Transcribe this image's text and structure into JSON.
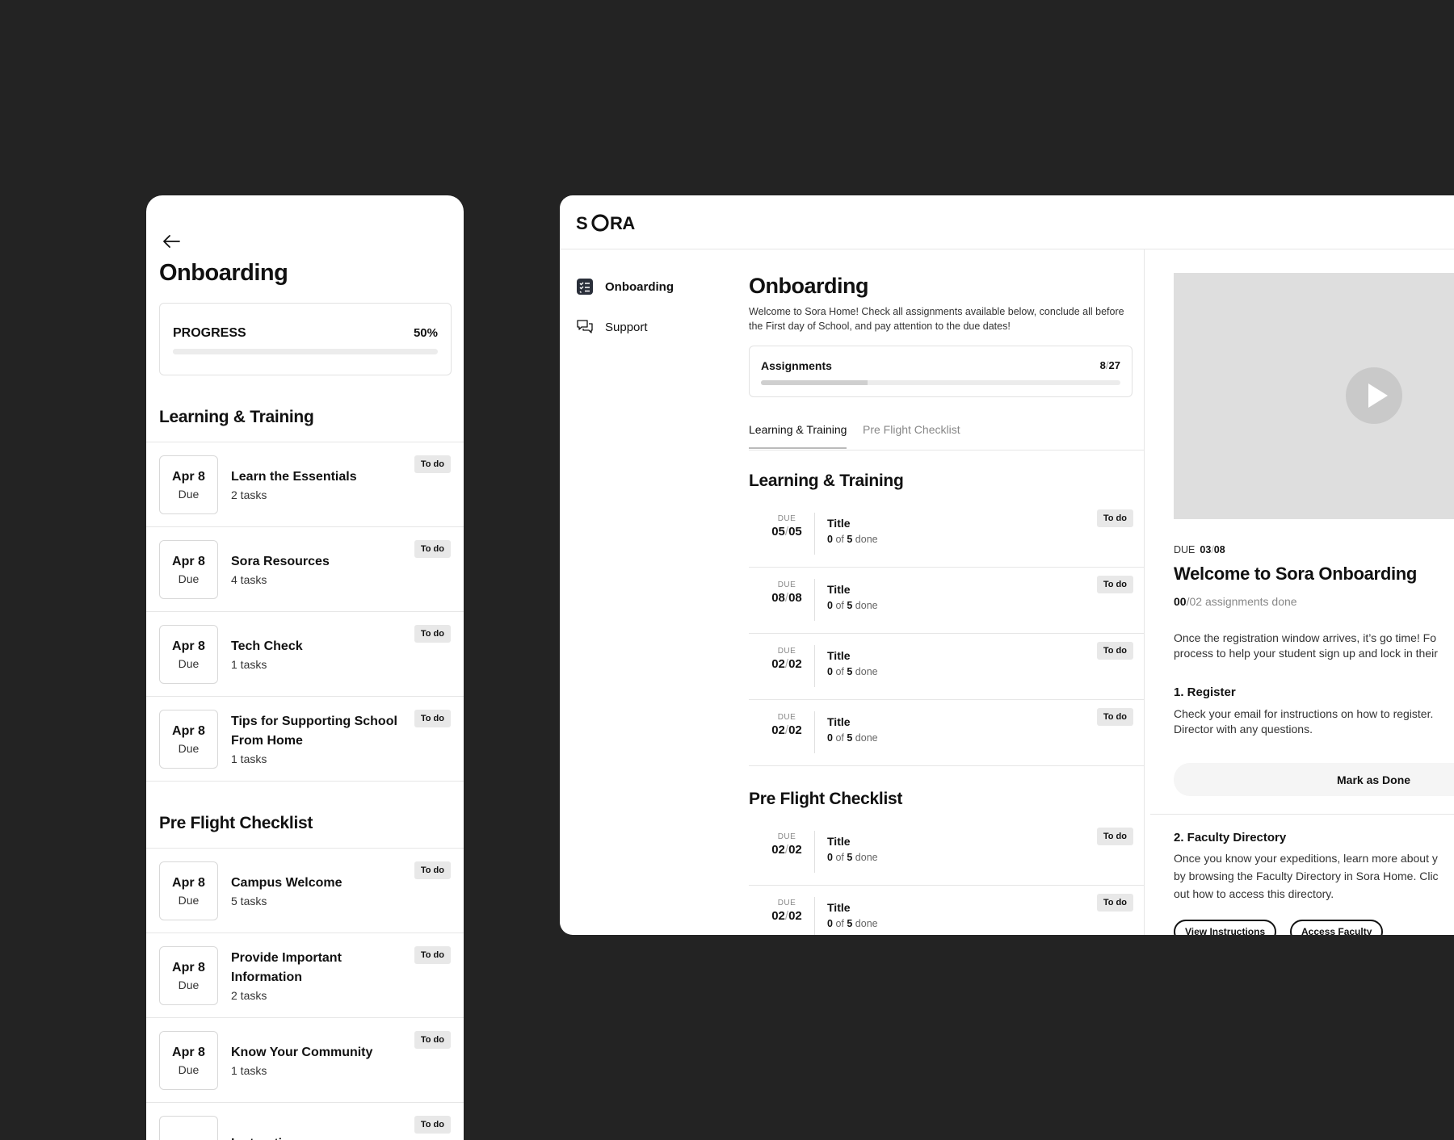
{
  "mobile": {
    "title": "Onboarding",
    "progress": {
      "label": "PROGRESS",
      "percent_text": "50%",
      "value": 0.5
    },
    "learning_title": "Learning & Training",
    "learning_items": [
      {
        "date": "Apr 8",
        "due": "Due",
        "title": "Learn the Essentials",
        "tasks": "2 tasks",
        "status": "To do"
      },
      {
        "date": "Apr 8",
        "due": "Due",
        "title": "Sora Resources",
        "tasks": "4 tasks",
        "status": "To do"
      },
      {
        "date": "Apr 8",
        "due": "Due",
        "title": "Tech Check",
        "tasks": "1 tasks",
        "status": "To do"
      },
      {
        "date": "Apr 8",
        "due": "Due",
        "title": "Tips for Supporting School From Home",
        "tasks": "1 tasks",
        "status": "To do"
      }
    ],
    "preflight_title": "Pre Flight Checklist",
    "preflight_items": [
      {
        "date": "Apr 8",
        "due": "Due",
        "title": "Campus Welcome",
        "tasks": "5 tasks",
        "status": "To do"
      },
      {
        "date": "Apr 8",
        "due": "Due",
        "title": "Provide Important Information",
        "tasks": "2 tasks",
        "status": "To do"
      },
      {
        "date": "Apr 8",
        "due": "Due",
        "title": "Know Your Community",
        "tasks": "1 tasks",
        "status": "To do"
      },
      {
        "date": "",
        "due": "",
        "title": "Instructions on",
        "tasks": "",
        "status": "To do"
      }
    ]
  },
  "desktop": {
    "logo_text": "SORA",
    "nav": [
      {
        "label": "Onboarding",
        "icon": "checklist-icon",
        "active": true
      },
      {
        "label": "Support",
        "icon": "chat-bubbles-icon",
        "active": false
      }
    ],
    "title": "Onboarding",
    "description": "Welcome to Sora Home! Check all assignments available below, conclude all before the First day of School, and pay attention to the due dates!",
    "assignments": {
      "label": "Assignments",
      "done": "8",
      "slash": "/",
      "total": "27",
      "value_done": 8,
      "value_total": 27
    },
    "tabs": [
      {
        "label": "Learning & Training",
        "active": true
      },
      {
        "label": "Pre Flight Checklist",
        "active": false
      }
    ],
    "learning_title": "Learning & Training",
    "learning_items": [
      {
        "due_label": "DUE",
        "month": "05",
        "day": "05",
        "title": "Title",
        "done": "0",
        "total": "5",
        "of": "of",
        "done_word": "done",
        "status": "To do"
      },
      {
        "due_label": "DUE",
        "month": "08",
        "day": "08",
        "title": "Title",
        "done": "0",
        "total": "5",
        "of": "of",
        "done_word": "done",
        "status": "To do"
      },
      {
        "due_label": "DUE",
        "month": "02",
        "day": "02",
        "title": "Title",
        "done": "0",
        "total": "5",
        "of": "of",
        "done_word": "done",
        "status": "To do"
      },
      {
        "due_label": "DUE",
        "month": "02",
        "day": "02",
        "title": "Title",
        "done": "0",
        "total": "5",
        "of": "of",
        "done_word": "done",
        "status": "To do"
      }
    ],
    "preflight_title": "Pre Flight Checklist",
    "preflight_items": [
      {
        "due_label": "DUE",
        "month": "02",
        "day": "02",
        "title": "Title",
        "done": "0",
        "total": "5",
        "of": "of",
        "done_word": "done",
        "status": "To do"
      },
      {
        "due_label": "DUE",
        "month": "02",
        "day": "02",
        "title": "Title",
        "done": "0",
        "total": "5",
        "of": "of",
        "done_word": "done",
        "status": "To do"
      }
    ],
    "detail": {
      "due_label": "DUE",
      "due_month": "03",
      "due_day": "08",
      "title": "Welcome to Sora Onboarding",
      "count_done": "00",
      "count_total": "02",
      "count_suffix": "assignments done",
      "intro_line1": "Once the registration window arrives, it’s go time! Fo",
      "intro_line2": "process to help your student sign up and lock in their",
      "step1_title": "1. Register",
      "step1_line1": "Check your email for instructions on how to register.",
      "step1_line2": "Director with any questions.",
      "mark_done": "Mark as Done",
      "step2_title": "2. Faculty Directory",
      "step2_line1": "Once you know your expeditions, learn more about y",
      "step2_line2": "by browsing the Faculty Directory in Sora Home. Clic",
      "step2_line3": "out how to access this directory.",
      "btn_instructions": "View Instructions",
      "btn_faculty": "Access Faculty"
    }
  }
}
